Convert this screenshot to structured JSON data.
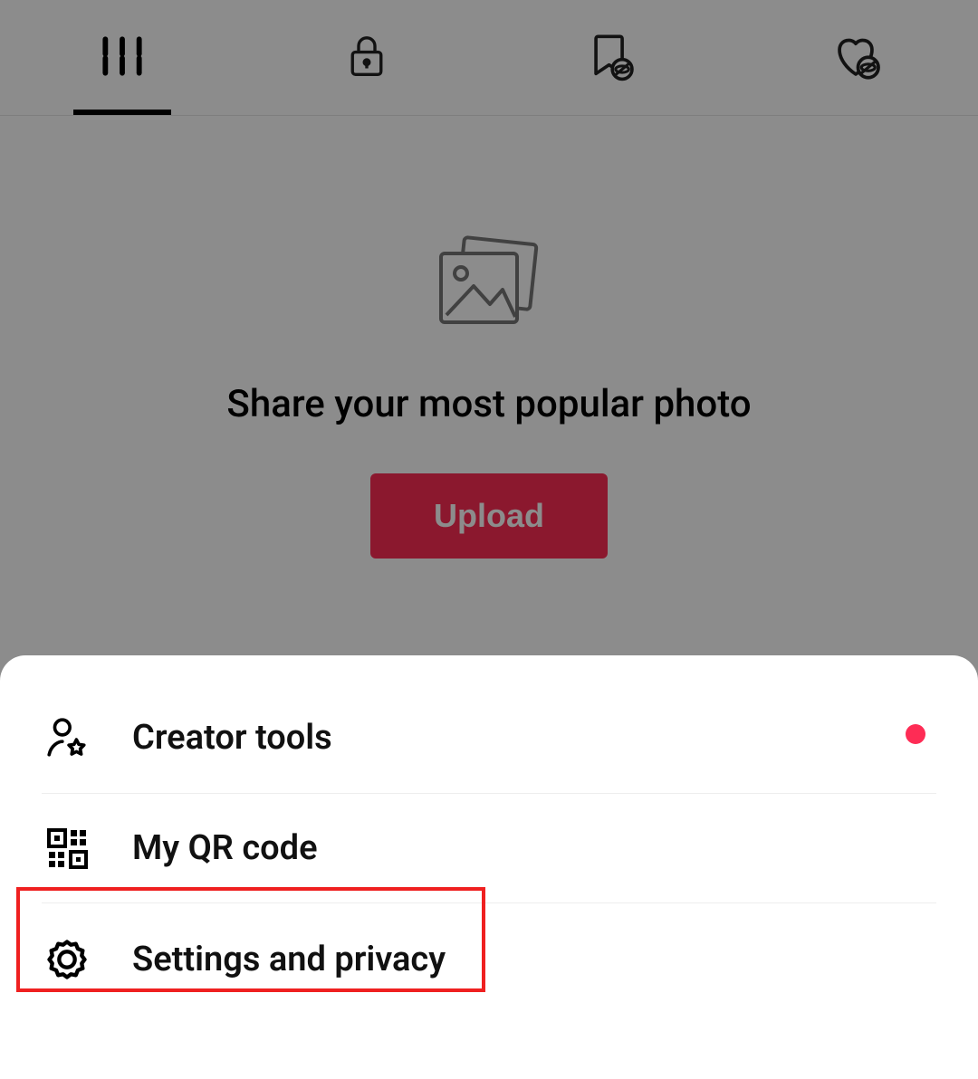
{
  "tabs": {
    "items": [
      {
        "icon": "grid"
      },
      {
        "icon": "lock"
      },
      {
        "icon": "bookmark-hidden"
      },
      {
        "icon": "heart-hidden"
      }
    ]
  },
  "empty_state": {
    "title": "Share your most popular photo",
    "upload_label": "Upload"
  },
  "menu": {
    "items": [
      {
        "icon": "person-star",
        "label": "Creator tools",
        "has_badge": true
      },
      {
        "icon": "qr-code",
        "label": "My QR code",
        "has_badge": false
      },
      {
        "icon": "gear",
        "label": "Settings and privacy",
        "has_badge": false
      }
    ]
  },
  "colors": {
    "accent": "#fe2c55",
    "annotation": "#ef2020"
  }
}
